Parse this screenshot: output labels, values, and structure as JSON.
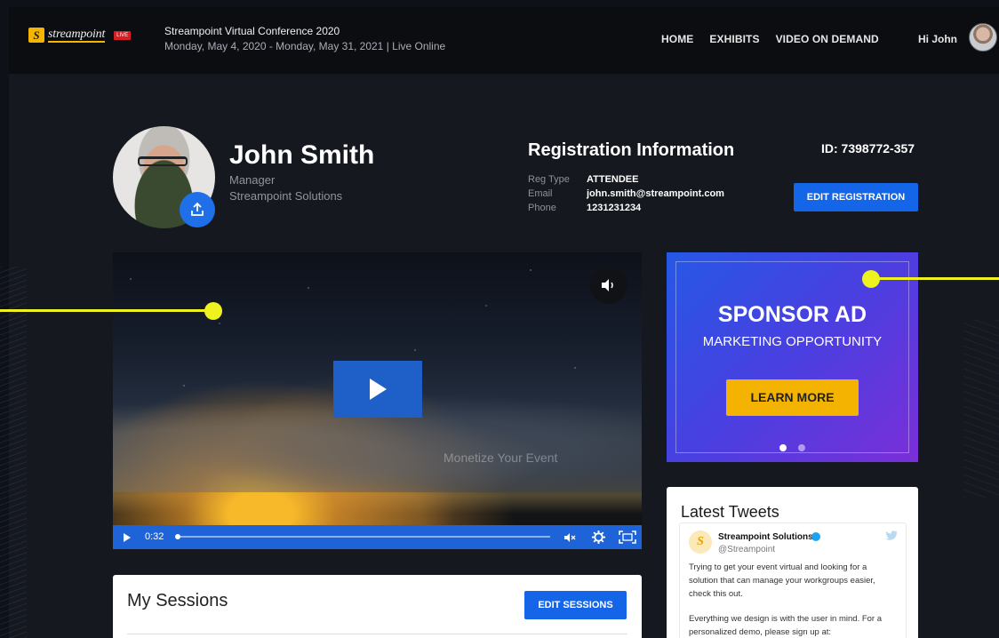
{
  "header": {
    "logo_text": "streampoint",
    "logo_badge": "LIVE",
    "conference_title": "Streampoint Virtual Conference 2020",
    "conference_dates": "Monday, May 4, 2020 - Monday, May 31, 2021 | Live Online",
    "nav": [
      "HOME",
      "EXHIBITS",
      "VIDEO ON DEMAND"
    ],
    "greeting": "Hi John"
  },
  "profile": {
    "name": "John Smith",
    "role": "Manager",
    "company": "Streampoint Solutions"
  },
  "registration": {
    "title": "Registration Information",
    "id": "ID: 7398772-357",
    "rows": [
      {
        "label": "Reg Type",
        "value": "ATTENDEE"
      },
      {
        "label": "Email",
        "value": "john.smith@streampoint.com"
      },
      {
        "label": "Phone",
        "value": "1231231234"
      }
    ],
    "edit_label": "EDIT REGISTRATION"
  },
  "video": {
    "watermark": "Monetize Your Event",
    "time": "0:32",
    "progress": 0.0
  },
  "sponsor_ad": {
    "title": "SPONSOR AD",
    "subtitle": "MARKETING OPPORTUNITY",
    "button_label": "LEARN MORE",
    "slides": 2,
    "active_slide": 1
  },
  "tweets": {
    "title": "Latest Tweets",
    "account_name": "Streampoint Solutions",
    "handle": "@Streampoint",
    "text1": "Trying to get your event virtual and looking for a solution that can manage your workgroups easier, check this out.",
    "text2": "Everything we design is with the user in mind. For a personalized demo, please sign up at:"
  },
  "sessions": {
    "title": "My Sessions",
    "edit_label": "EDIT SESSIONS"
  },
  "colors": {
    "accent_blue": "#1565e8",
    "ad_yellow": "#f5b301",
    "annotation_yellow": "#eef21f"
  }
}
